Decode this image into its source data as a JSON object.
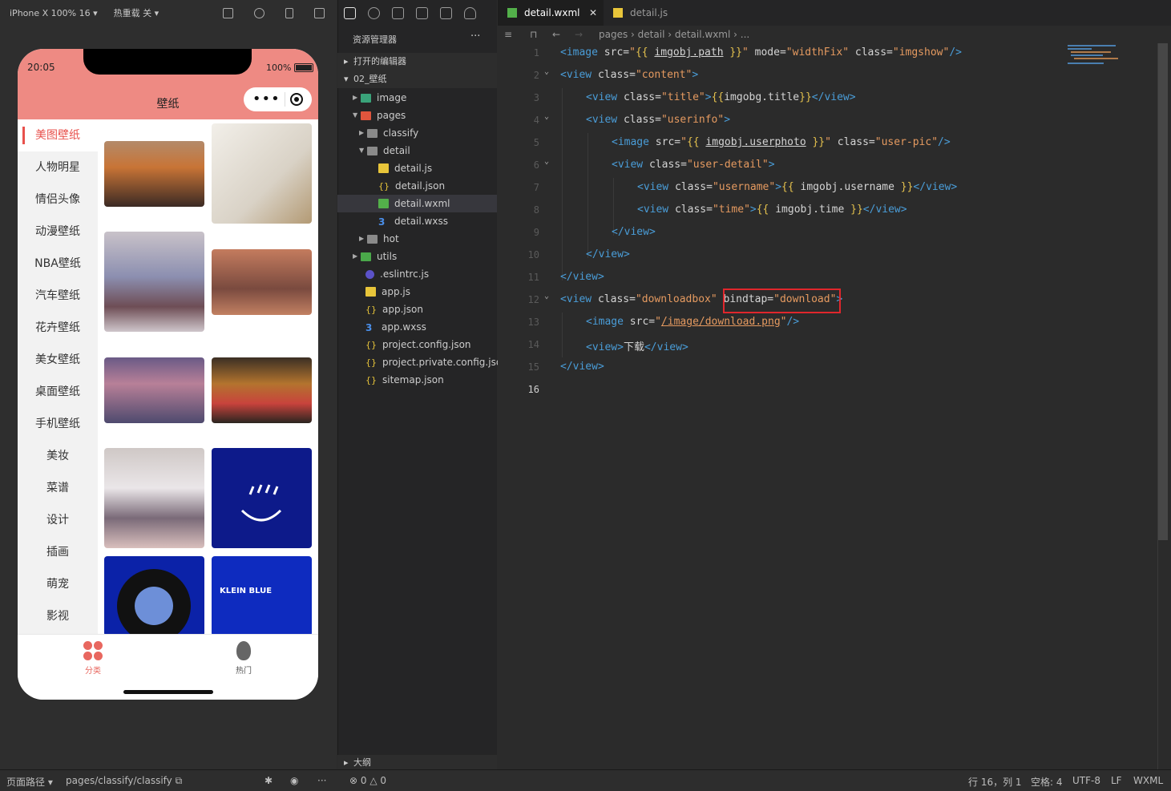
{
  "sim_toolbar": {
    "device": "iPhone X 100% 16",
    "hotreload": "热重载 关"
  },
  "phone": {
    "time": "20:05",
    "battery": "100%",
    "title": "壁纸",
    "categories": [
      "美图壁纸",
      "人物明星",
      "情侣头像",
      "动漫壁纸",
      "NBA壁纸",
      "汽车壁纸",
      "花卉壁纸",
      "美女壁纸",
      "桌面壁纸",
      "手机壁纸",
      "美妆",
      "菜谱",
      "设计",
      "插画",
      "萌宠",
      "影视"
    ],
    "active_category": "美图壁纸",
    "tabs": [
      {
        "label": "分类",
        "color": "#e8675f"
      },
      {
        "label": "热门",
        "color": "#555555"
      }
    ],
    "thumb_text": "KLEIN BLUE"
  },
  "explorer": {
    "title": "资源管理器",
    "more": "···",
    "open_editors": "打开的编辑器",
    "project": "02_壁纸",
    "outline": "大纲",
    "tree": [
      {
        "label": "image",
        "type": "folder",
        "depth": 1,
        "open": false
      },
      {
        "label": "pages",
        "type": "folder",
        "depth": 1,
        "open": true
      },
      {
        "label": "classify",
        "type": "folder",
        "depth": 2,
        "open": false
      },
      {
        "label": "detail",
        "type": "folder",
        "depth": 2,
        "open": true
      },
      {
        "label": "detail.js",
        "type": "js",
        "depth": 3
      },
      {
        "label": "detail.json",
        "type": "json",
        "depth": 3
      },
      {
        "label": "detail.wxml",
        "type": "wxml",
        "depth": 3,
        "selected": true
      },
      {
        "label": "detail.wxss",
        "type": "wxss",
        "depth": 3
      },
      {
        "label": "hot",
        "type": "folder",
        "depth": 2,
        "open": false
      },
      {
        "label": "utils",
        "type": "folder",
        "depth": 1,
        "open": false
      },
      {
        "label": ".eslintrc.js",
        "type": "eslint",
        "depth": 1
      },
      {
        "label": "app.js",
        "type": "js",
        "depth": 1
      },
      {
        "label": "app.json",
        "type": "json",
        "depth": 1
      },
      {
        "label": "app.wxss",
        "type": "wxss",
        "depth": 1
      },
      {
        "label": "project.config.json",
        "type": "json",
        "depth": 1
      },
      {
        "label": "project.private.config.json",
        "type": "json",
        "depth": 1
      },
      {
        "label": "sitemap.json",
        "type": "json",
        "depth": 1
      }
    ]
  },
  "editor": {
    "tabs": [
      "detail.wxml",
      "detail.js"
    ],
    "breadcrumb": [
      "pages",
      "detail",
      "detail.wxml",
      "..."
    ],
    "line_numbers": [
      "1",
      "2",
      "3",
      "4",
      "5",
      "6",
      "7",
      "8",
      "9",
      "10",
      "11",
      "12",
      "13",
      "14",
      "15",
      "16"
    ],
    "current_line": "16",
    "highlight_text": "bindtap=\"download\""
  },
  "status": {
    "page_path_label": "页面路径",
    "page_path": "pages/classify/classify",
    "errors": "0",
    "warnings": "0",
    "cursor": "行 16，列 1",
    "spaces": "空格: 4",
    "encoding": "UTF-8",
    "eol": "LF",
    "lang": "WXML"
  }
}
